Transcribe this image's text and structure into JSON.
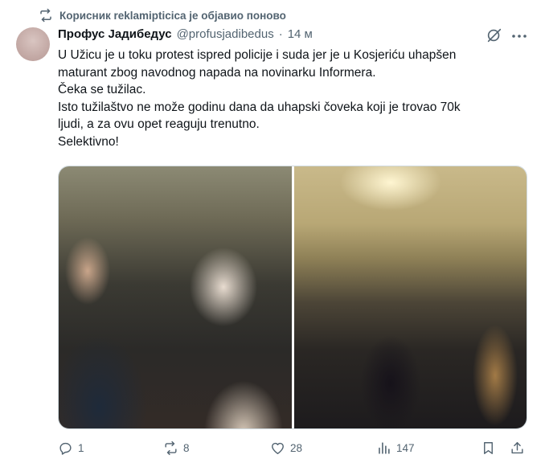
{
  "repost_banner": {
    "text": "Корисник reklamipticica је објавио поново",
    "icon": "repost-icon"
  },
  "author": {
    "name": "Профус Јадибедус",
    "handle": "@profusjadibedus",
    "separator": "·",
    "time": "14 м"
  },
  "tweet": {
    "lines": [
      "U Užicu je u toku protest ispred policije i suda jer je u Kosjeriću uhapšen",
      "maturant zbog navodnog napada na novinarku Informera.",
      "Čeka se tužilac.",
      "Isto tužilaštvo ne može godinu dana da uhapski čoveka koji je trovao 70k",
      "ljudi, a za ovu opet reaguju trenutno.",
      "Selektivno!"
    ]
  },
  "media": {
    "count": 2
  },
  "actions": {
    "replies": "1",
    "reposts": "8",
    "likes": "28",
    "views": "147"
  },
  "colors": {
    "text": "#0f1419",
    "secondary": "#536471",
    "border": "#cfd9de"
  }
}
